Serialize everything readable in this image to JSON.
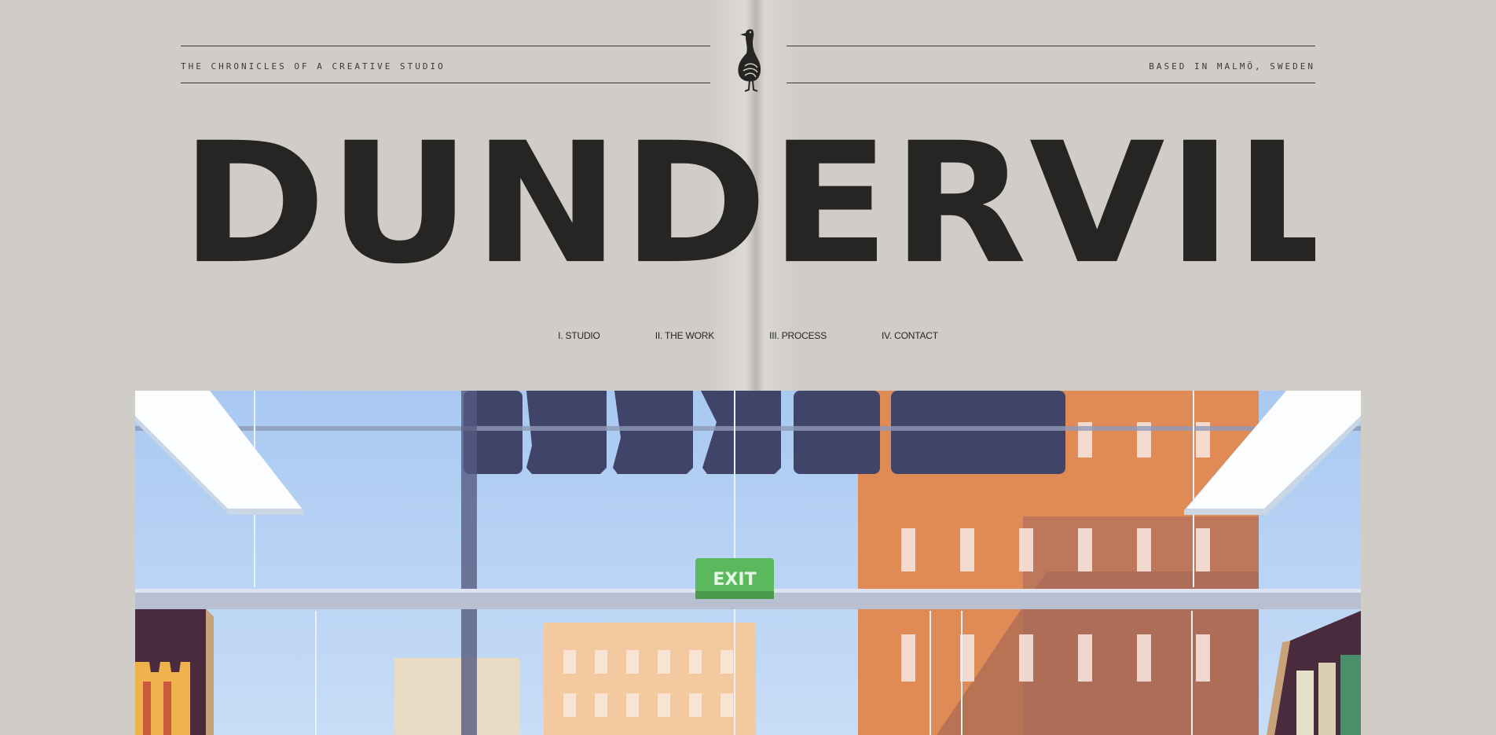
{
  "header": {
    "tagline_left": "THE CHRONICLES OF A CREATIVE STUDIO",
    "tagline_right": "BASED IN MALMÖ, SWEDEN",
    "logo_icon": "goose-icon",
    "wordmark": "DUNDERVILLE"
  },
  "nav": {
    "items": [
      {
        "label": "I. STUDIO"
      },
      {
        "label": "II. THE WORK"
      },
      {
        "label": "III. PROCESS"
      },
      {
        "label": "IV. CONTACT"
      }
    ]
  },
  "hero": {
    "exit_sign": "EXIT"
  },
  "colors": {
    "background": "#d0cdc8",
    "ink": "#262524",
    "sky": "#b9d4f3",
    "building_orange": "#e08a55",
    "exit_green": "#5cb85c"
  }
}
